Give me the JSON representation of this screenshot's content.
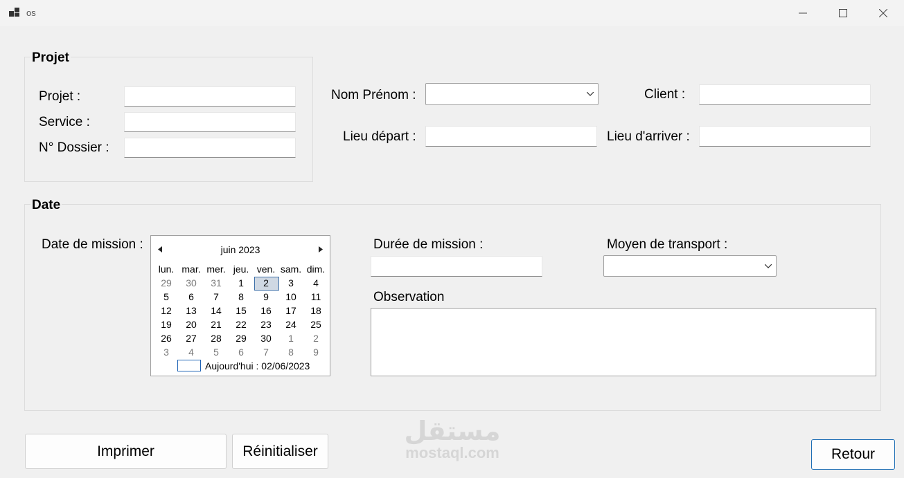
{
  "window": {
    "title": "os"
  },
  "projet_group": {
    "title": "Projet",
    "projet_label": "Projet :",
    "service_label": "Service :",
    "dossier_label": "N° Dossier :",
    "projet_value": "",
    "service_value": "",
    "dossier_value": ""
  },
  "top_fields": {
    "nom_prenom_label": "Nom Prénom :",
    "nom_prenom_value": "",
    "client_label": "Client :",
    "client_value": "",
    "lieu_depart_label": "Lieu départ :",
    "lieu_depart_value": "",
    "lieu_arriver_label": "Lieu d'arriver :",
    "lieu_arriver_value": ""
  },
  "date_group": {
    "title": "Date",
    "date_mission_label": "Date de mission :",
    "duree_label": "Durée de mission :",
    "duree_value": "",
    "transport_label": "Moyen de transport :",
    "transport_value": "",
    "observation_label": "Observation",
    "observation_value": ""
  },
  "calendar": {
    "month": "juin 2023",
    "weekdays": [
      "lun.",
      "mar.",
      "mer.",
      "jeu.",
      "ven.",
      "sam.",
      "dim."
    ],
    "weeks": [
      [
        {
          "d": "29",
          "o": true
        },
        {
          "d": "30",
          "o": true
        },
        {
          "d": "31",
          "o": true
        },
        {
          "d": "1"
        },
        {
          "d": "2",
          "sel": true
        },
        {
          "d": "3"
        },
        {
          "d": "4"
        }
      ],
      [
        {
          "d": "5"
        },
        {
          "d": "6"
        },
        {
          "d": "7"
        },
        {
          "d": "8"
        },
        {
          "d": "9"
        },
        {
          "d": "10"
        },
        {
          "d": "11"
        }
      ],
      [
        {
          "d": "12"
        },
        {
          "d": "13"
        },
        {
          "d": "14"
        },
        {
          "d": "15"
        },
        {
          "d": "16"
        },
        {
          "d": "17"
        },
        {
          "d": "18"
        }
      ],
      [
        {
          "d": "19"
        },
        {
          "d": "20"
        },
        {
          "d": "21"
        },
        {
          "d": "22"
        },
        {
          "d": "23"
        },
        {
          "d": "24"
        },
        {
          "d": "25"
        }
      ],
      [
        {
          "d": "26"
        },
        {
          "d": "27"
        },
        {
          "d": "28"
        },
        {
          "d": "29"
        },
        {
          "d": "30"
        },
        {
          "d": "1",
          "o": true
        },
        {
          "d": "2",
          "o": true
        }
      ],
      [
        {
          "d": "3",
          "o": true
        },
        {
          "d": "4",
          "o": true
        },
        {
          "d": "5",
          "o": true
        },
        {
          "d": "6",
          "o": true
        },
        {
          "d": "7",
          "o": true
        },
        {
          "d": "8",
          "o": true
        },
        {
          "d": "9",
          "o": true
        }
      ]
    ],
    "today_text": "Aujourd'hui : 02/06/2023"
  },
  "buttons": {
    "imprimer": "Imprimer",
    "reinitialiser": "Réinitialiser",
    "retour": "Retour"
  },
  "watermark": {
    "arabic": "مستقل",
    "latin": "mostaql.com"
  },
  "colors": {
    "accent": "#1f6fb5",
    "background": "#f0f0f0",
    "selected_day": "#cfd8e3"
  }
}
